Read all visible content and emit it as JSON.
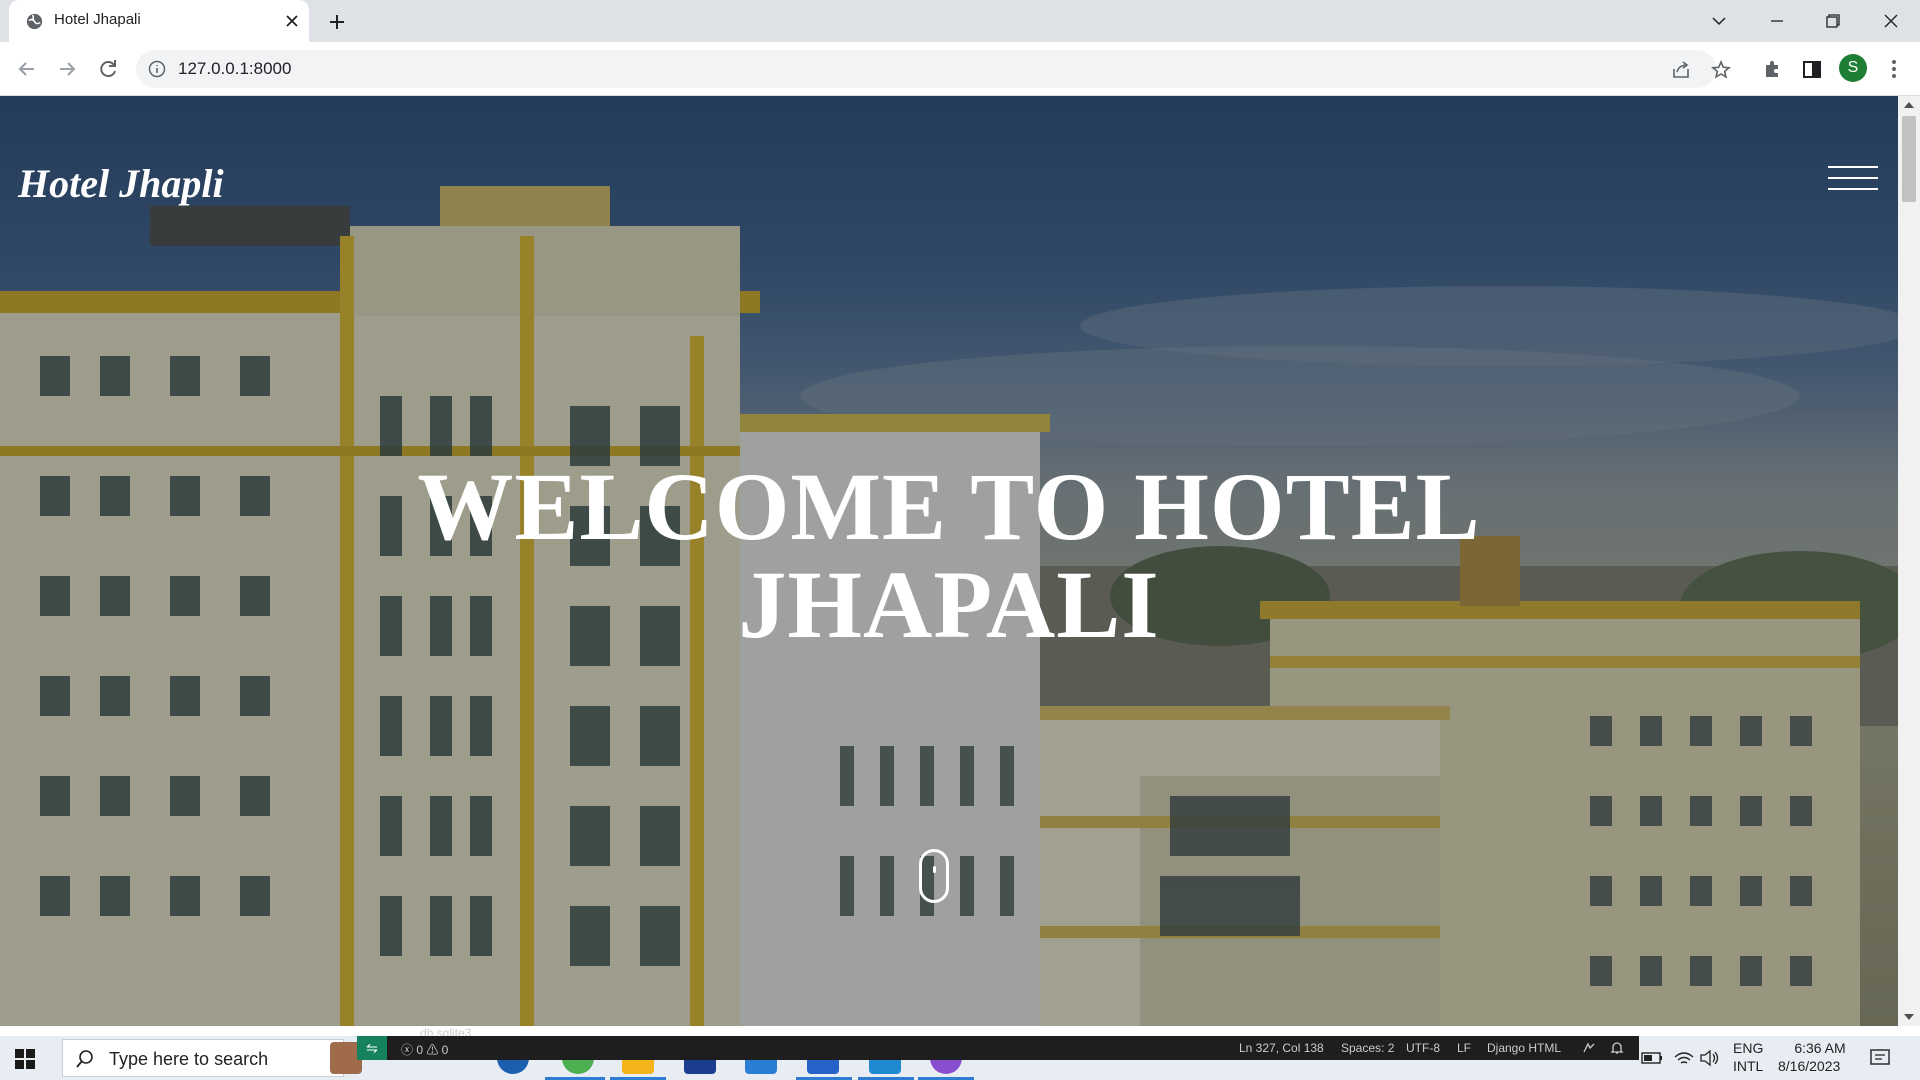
{
  "browser": {
    "tab_title": "Hotel Jhapali",
    "url": "127.0.0.1:8000",
    "profile_initial": "S"
  },
  "page": {
    "brand": "Hotel Jhapli",
    "hero_line1": "WELCOME TO HOTEL",
    "hero_line2": "JHAPALI"
  },
  "vscode_status": {
    "file_tab": "db.sqlite3",
    "problems": "ⓧ 0 ⚠ 0",
    "cursor": "Ln 327, Col 138",
    "spaces": "Spaces: 2",
    "encoding": "UTF-8",
    "eol": "LF",
    "language": "Django HTML"
  },
  "taskbar": {
    "search_placeholder": "Type here to search",
    "lang_top": "ENG",
    "lang_bottom": "INTL",
    "time": "6:36 AM",
    "date": "8/16/2023"
  },
  "colors": {
    "accent_vscode_remote": "#16825d",
    "profile_green": "#1e7e34"
  }
}
